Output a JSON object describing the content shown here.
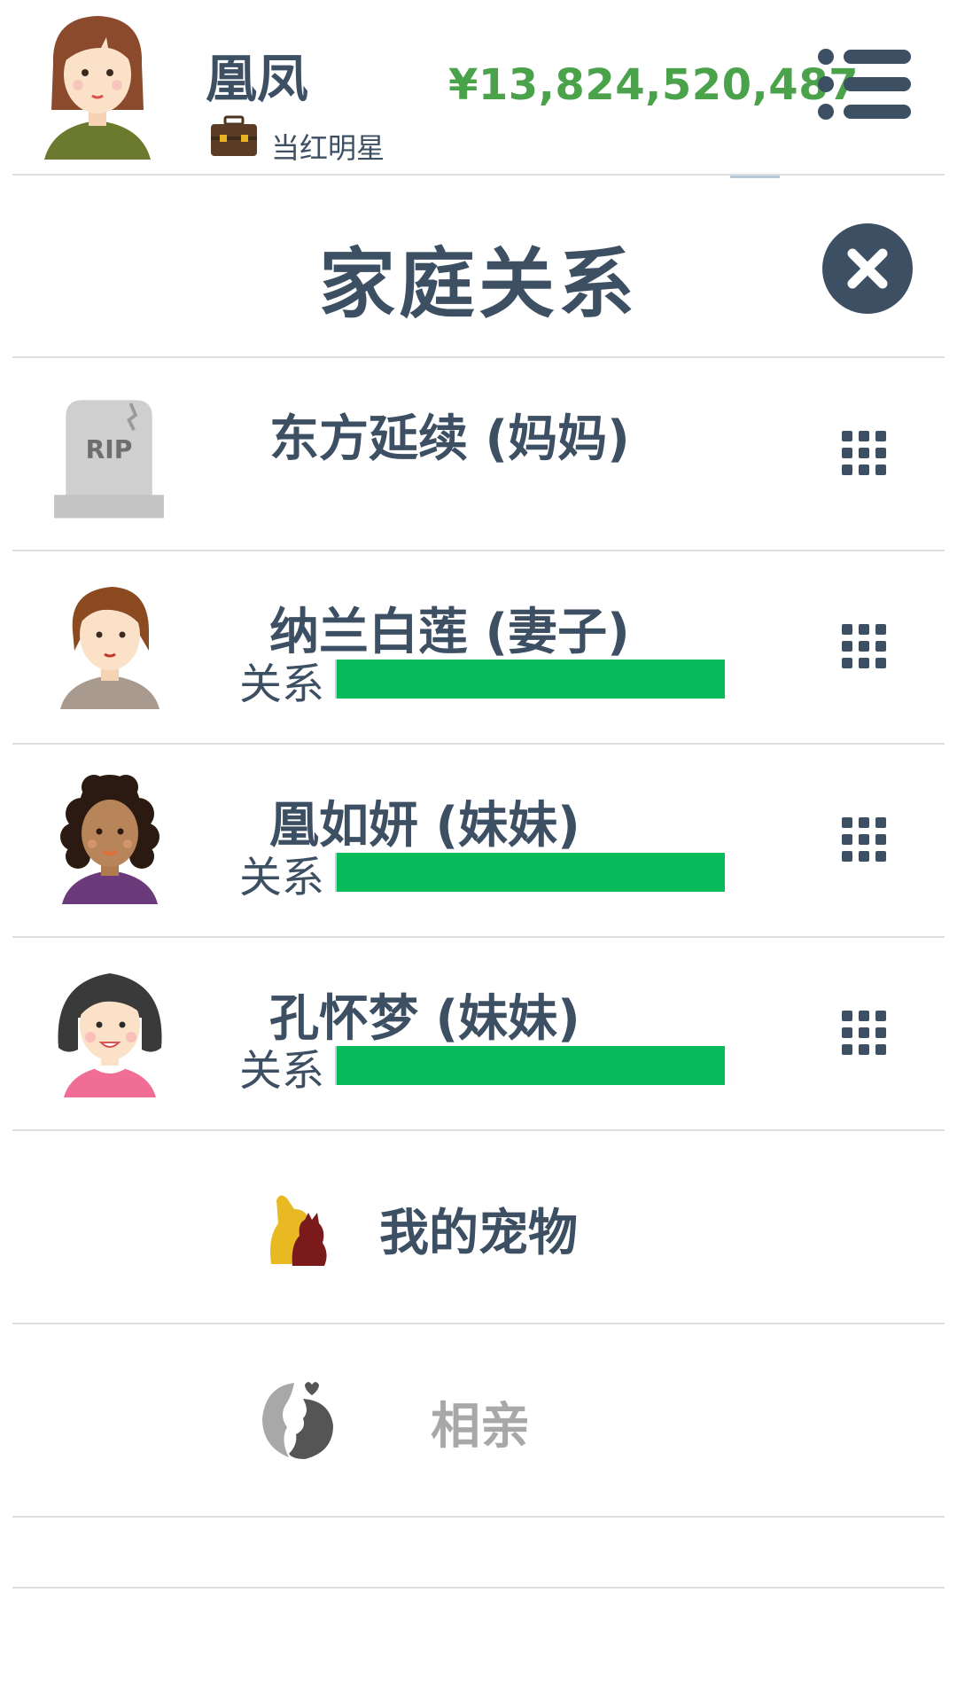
{
  "header": {
    "player_name": "凰凤",
    "job_title": "当红明星",
    "money": "¥13,824,520,487",
    "icons": {
      "avatar": "player-avatar",
      "job": "briefcase-icon",
      "menu": "menu-icon"
    }
  },
  "panel": {
    "title": "家庭关系",
    "close_icon": "close-icon"
  },
  "family": [
    {
      "name": "东方延续 (妈妈)",
      "deceased": true,
      "avatar": "tombstone-rip",
      "rip_text": "RIP"
    },
    {
      "name": "纳兰白莲 (妻子)",
      "deceased": false,
      "avatar": "wife-avatar",
      "relation_label": "关系",
      "relation_level": 1.0
    },
    {
      "name": "凰如妍 (妹妹)",
      "deceased": false,
      "avatar": "sister-avatar-curly",
      "relation_label": "关系",
      "relation_level": 1.0
    },
    {
      "name": "孔怀梦 (妹妹)",
      "deceased": false,
      "avatar": "sister-avatar-dark-hair",
      "relation_label": "关系",
      "relation_level": 1.0
    }
  ],
  "features": [
    {
      "label": "我的宠物",
      "icon": "pets-icon",
      "enabled": true,
      "color": "#3d4f63"
    },
    {
      "label": "相亲",
      "icon": "dating-icon",
      "enabled": false,
      "color": "#a8a8a8"
    }
  ],
  "colors": {
    "text": "#3d4f63",
    "money": "#4aa24a",
    "relation_bar": "#07bb5a",
    "disabled": "#a8a8a8"
  }
}
